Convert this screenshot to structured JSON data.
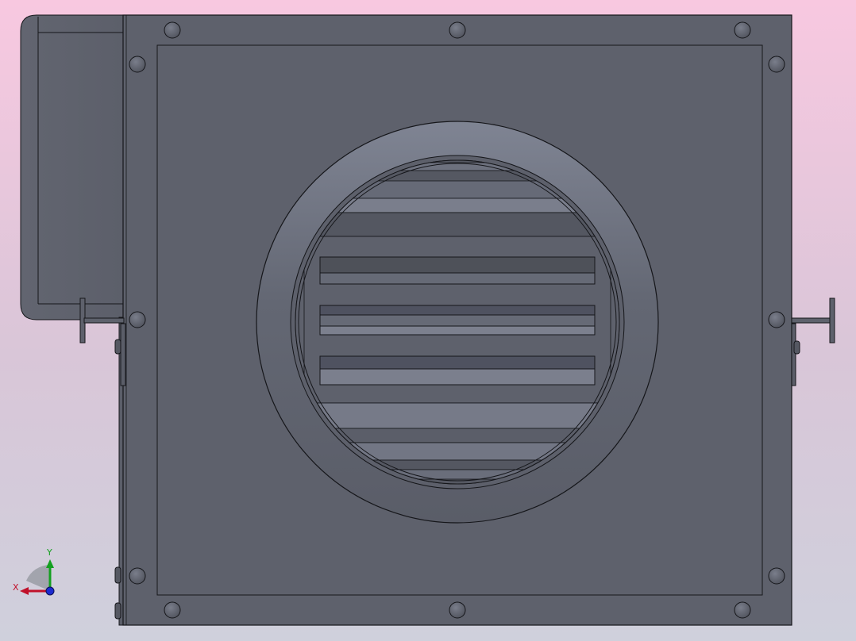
{
  "view": {
    "background_top": "#f8c8e0",
    "background_bottom": "#cfd0dc"
  },
  "model": {
    "part_color": "#5e616c",
    "edge_color": "#15161a",
    "highlight_color": "#7f8493",
    "component": "centrifugal-fan-housing"
  },
  "triad": {
    "x_label": "X",
    "y_label": "Y",
    "x_color": "#c0102a",
    "y_color": "#14a020",
    "z_color": "#1c2ad0"
  }
}
